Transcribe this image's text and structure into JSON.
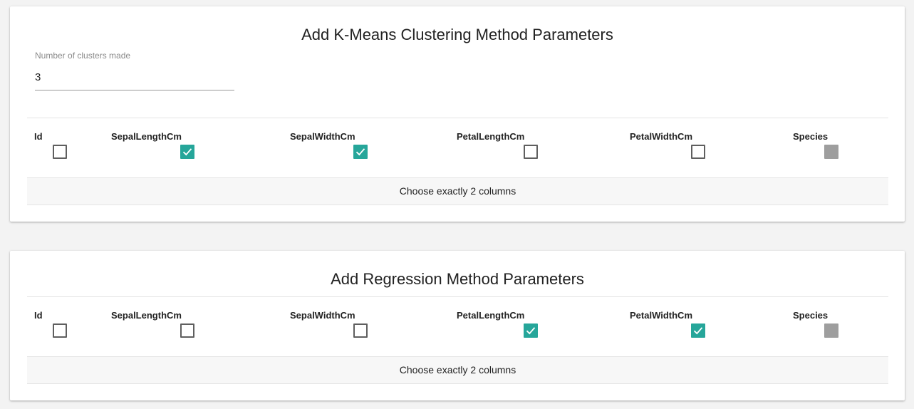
{
  "kmeans": {
    "title": "Add K-Means Clustering Method Parameters",
    "clusters_label": "Number of clusters made",
    "clusters_value": "3",
    "columns": [
      {
        "label": "Id",
        "state": "unchecked"
      },
      {
        "label": "SepalLengthCm",
        "state": "checked"
      },
      {
        "label": "SepalWidthCm",
        "state": "checked"
      },
      {
        "label": "PetalLengthCm",
        "state": "unchecked"
      },
      {
        "label": "PetalWidthCm",
        "state": "unchecked"
      },
      {
        "label": "Species",
        "state": "disabled"
      }
    ],
    "hint": "Choose exactly 2 columns"
  },
  "regression": {
    "title": "Add Regression Method Parameters",
    "columns": [
      {
        "label": "Id",
        "state": "unchecked"
      },
      {
        "label": "SepalLengthCm",
        "state": "unchecked"
      },
      {
        "label": "SepalWidthCm",
        "state": "unchecked"
      },
      {
        "label": "PetalLengthCm",
        "state": "checked"
      },
      {
        "label": "PetalWidthCm",
        "state": "checked"
      },
      {
        "label": "Species",
        "state": "disabled"
      }
    ],
    "hint": "Choose exactly 2 columns"
  },
  "colors": {
    "accent": "#26a69a",
    "disabled": "#9e9e9e",
    "background": "#f3f3f3"
  }
}
